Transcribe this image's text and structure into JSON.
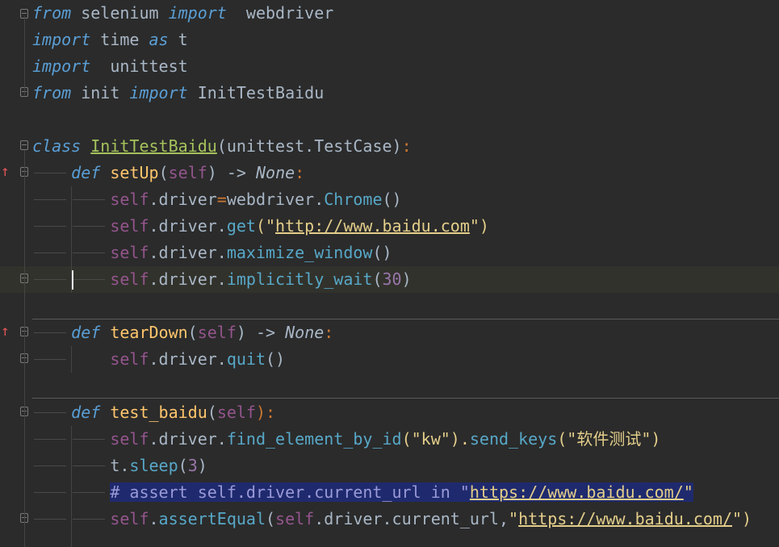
{
  "lines": [
    {
      "parts": [
        "from",
        " selenium ",
        "import",
        "  webdriver"
      ]
    },
    {
      "parts": [
        "import",
        " time ",
        "as",
        " t"
      ]
    },
    {
      "parts": [
        "import",
        "  unittest"
      ]
    },
    {
      "parts": [
        "from",
        " init ",
        "import",
        " InitTestBaidu"
      ]
    },
    {
      "parts": [
        ""
      ]
    },
    {
      "parts": [
        "class",
        " ",
        "InitTestBaidu",
        "(unittest.TestCase)",
        ":"
      ]
    },
    {
      "parts": [
        "    ",
        "def",
        " ",
        "setUp",
        "(",
        "self",
        ") -> ",
        "None",
        ":"
      ]
    },
    {
      "parts": [
        "        ",
        "self",
        ".driver",
        "=",
        "webdriver.",
        "Chrome",
        "()"
      ]
    },
    {
      "parts": [
        "        ",
        "self",
        ".driver.",
        "get",
        "(\"",
        "http://www.baidu.com",
        "\")"
      ]
    },
    {
      "parts": [
        "        ",
        "self",
        ".driver.",
        "maximize_window",
        "()"
      ]
    },
    {
      "parts": [
        "        ",
        "self",
        ".driver.",
        "implicitly_wait",
        "(",
        "30",
        ")"
      ]
    },
    {
      "parts": [
        ""
      ]
    },
    {
      "parts": [
        "    ",
        "def",
        " ",
        "tearDown",
        "(",
        "self",
        ") -> ",
        "None",
        ":"
      ]
    },
    {
      "parts": [
        "        ",
        "self",
        ".driver.",
        "quit",
        "()"
      ]
    },
    {
      "parts": [
        ""
      ]
    },
    {
      "parts": [
        "    ",
        "def",
        " ",
        "test_baidu",
        "(",
        "self",
        "):"
      ]
    },
    {
      "parts": [
        "        ",
        "self",
        ".driver.",
        "find_element_by_id",
        "(\"kw\").",
        "send_keys",
        "(\"软件测试\")"
      ]
    },
    {
      "parts": [
        "        ",
        "t.",
        "sleep",
        "(",
        "3",
        ")"
      ]
    },
    {
      "parts": [
        "        ",
        "# assert self.driver.current_url in \"",
        "https://www.baidu.com/",
        "\""
      ]
    },
    {
      "parts": [
        "        ",
        "self",
        ".",
        "assertEqual",
        "(",
        "self",
        ".driver.current_url,",
        "\"",
        "https://www.baidu.com/",
        "\")"
      ]
    }
  ],
  "colors": {
    "background": "#2b2b2b",
    "current_line": "#32322c",
    "keyword": "#5a9fd6",
    "self": "#94558d",
    "string": "#e3ce8a",
    "class_name": "#a5c25c",
    "number": "#9876aa",
    "method": "#57a8c8",
    "override_marker": "#e05555"
  }
}
